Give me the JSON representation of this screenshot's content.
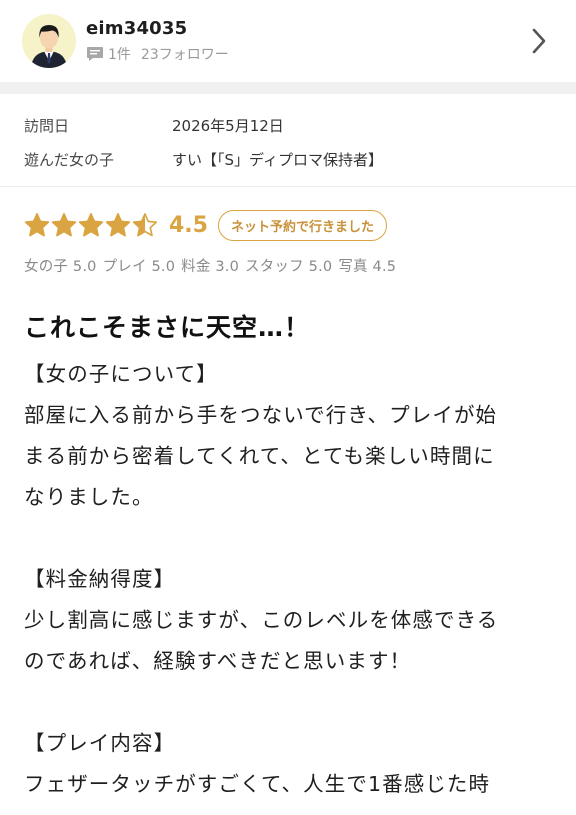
{
  "user": {
    "name": "eim34035",
    "review_count": "1件",
    "followers": "23フォロワー"
  },
  "visit": {
    "date_label": "訪問日",
    "date_value": "2026年5月12日",
    "girl_label": "遊んだ女の子",
    "girl_value": "すい【「S」ディプロマ保持者】"
  },
  "rating": {
    "overall": "4.5",
    "stars": 4.5,
    "star_color": "#d9a441",
    "badge": "ネット予約で行きました",
    "sub_scores": [
      "女の子 5.0",
      "プレイ 5.0",
      "料金 3.0",
      "スタッフ 5.0",
      "写真 4.5"
    ]
  },
  "review": {
    "title": "これこそまさに天空…！",
    "lines": [
      "【女の子について】",
      "部屋に入る前から手をつないで行き、プレイが始",
      "まる前から密着してくれて、とても楽しい時間に",
      "なりました。",
      "",
      "【料金納得度】",
      "少し割高に感じますが、このレベルを体感できる",
      "のであれば、経験すべきだと思います！",
      "",
      "【プレイ内容】",
      "フェザータッチがすごくて、人生で1番感じた時"
    ]
  },
  "icons": {
    "avatar": "person-avatar-icon",
    "comment": "comment-icon",
    "chevron": "chevron-right-icon",
    "star": "star-icon"
  }
}
